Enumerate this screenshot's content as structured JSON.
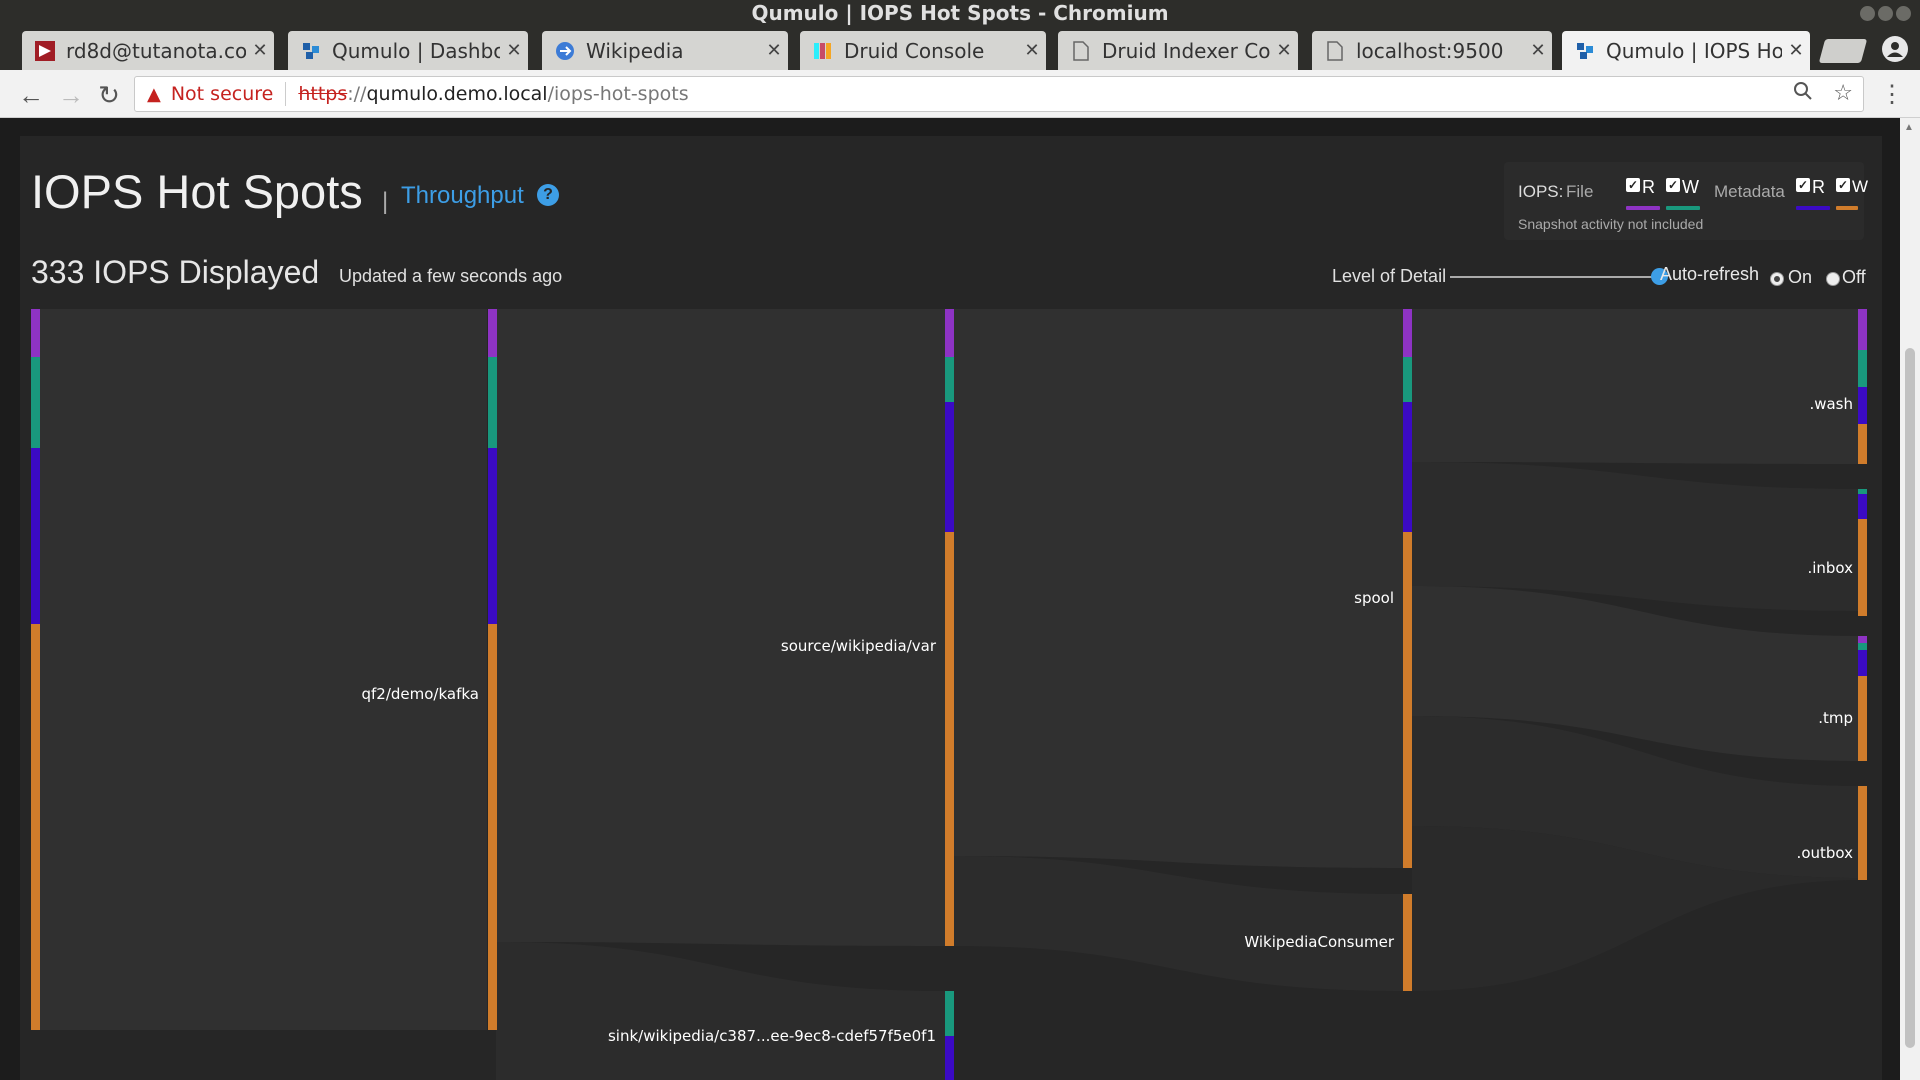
{
  "window": {
    "title": "Qumulo | IOPS Hot Spots - Chromium"
  },
  "tabs": [
    {
      "title": "rd8d@tutanota.co",
      "favicon": "tutanota-icon"
    },
    {
      "title": "Qumulo | Dashboa",
      "favicon": "qumulo-icon"
    },
    {
      "title": "Wikipedia",
      "favicon": "wikipedia-icon"
    },
    {
      "title": "Druid Console",
      "favicon": "druid-icon"
    },
    {
      "title": "Druid Indexer Coo",
      "favicon": "page-icon"
    },
    {
      "title": "localhost:9500",
      "favicon": "page-icon"
    },
    {
      "title": "Qumulo | IOPS Ho",
      "favicon": "qumulo-icon"
    }
  ],
  "toolbar": {
    "security_label": "Not secure",
    "url_scheme": "https",
    "url_sep": "://",
    "url_host": "qumulo.demo.local",
    "url_path": "/iops-hot-spots"
  },
  "page": {
    "title": "IOPS Hot Spots",
    "title_separator": "|",
    "throughput_link": "Throughput",
    "help_glyph": "?",
    "iops_count": "333 IOPS Displayed",
    "updated": "Updated a few seconds ago"
  },
  "legend": {
    "iops_label": "IOPS:",
    "file_label": "File",
    "metadata_label": "Metadata",
    "read_label": "R",
    "write_label": "W",
    "note": "Snapshot activity not included",
    "colors": {
      "file_read": "#8e33c4",
      "file_write": "#19987d",
      "meta_read": "#3b0ac4",
      "meta_write": "#d07c2b"
    }
  },
  "controls": {
    "level_of_detail_label": "Level of Detail",
    "level_of_detail_value": 1.0,
    "auto_refresh_label": "Auto-refresh",
    "on_label": "On",
    "off_label": "Off",
    "auto_refresh": "On"
  },
  "sankey": {
    "nodes": [
      {
        "id": "root",
        "label": ""
      },
      {
        "id": "kafka",
        "label": "qf2/demo/kafka"
      },
      {
        "id": "var",
        "label": "source/wikipedia/var"
      },
      {
        "id": "sink",
        "label": "sink/wikipedia/c387...ee-9ec8-cdef57f5e0f1"
      },
      {
        "id": "spool",
        "label": "spool"
      },
      {
        "id": "consumer",
        "label": "WikipediaConsumer"
      },
      {
        "id": "wash",
        "label": ".wash"
      },
      {
        "id": "inbox",
        "label": ".inbox"
      },
      {
        "id": "tmp",
        "label": ".tmp"
      },
      {
        "id": "outbox",
        "label": ".outbox"
      }
    ]
  }
}
